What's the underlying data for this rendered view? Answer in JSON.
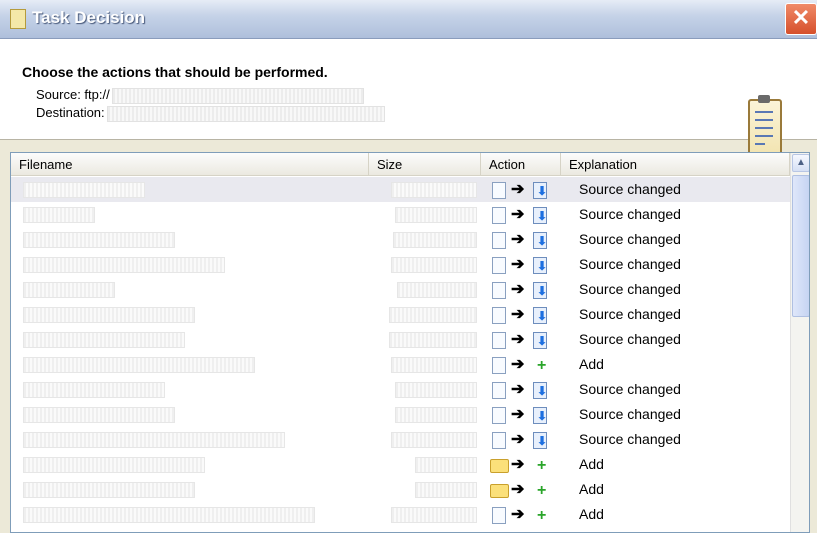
{
  "window": {
    "title": "Task Decision",
    "close_glyph": "✕"
  },
  "header": {
    "heading": "Choose the actions that should be performed.",
    "source_label": "Source: ftp://",
    "destination_label": "Destination:"
  },
  "columns": {
    "filename": "Filename",
    "size": "Size",
    "action": "Action",
    "explanation": "Explanation"
  },
  "rows": [
    {
      "icon": "file",
      "target": "download",
      "explanation": "Source changed"
    },
    {
      "icon": "file",
      "target": "download",
      "explanation": "Source changed"
    },
    {
      "icon": "file",
      "target": "download",
      "explanation": "Source changed"
    },
    {
      "icon": "file",
      "target": "download",
      "explanation": "Source changed"
    },
    {
      "icon": "file",
      "target": "download",
      "explanation": "Source changed"
    },
    {
      "icon": "file",
      "target": "download",
      "explanation": "Source changed"
    },
    {
      "icon": "file",
      "target": "download",
      "explanation": "Source changed"
    },
    {
      "icon": "file",
      "target": "add",
      "explanation": "Add"
    },
    {
      "icon": "file",
      "target": "download",
      "explanation": "Source changed"
    },
    {
      "icon": "file",
      "target": "download",
      "explanation": "Source changed"
    },
    {
      "icon": "file",
      "target": "download",
      "explanation": "Source changed"
    },
    {
      "icon": "folder",
      "target": "add",
      "explanation": "Add"
    },
    {
      "icon": "folder",
      "target": "add",
      "explanation": "Add"
    },
    {
      "icon": "file",
      "target": "add",
      "explanation": "Add"
    }
  ],
  "icons": {
    "arrow": "➔",
    "download": "⬇",
    "add": "+",
    "scroll_up": "▲"
  }
}
